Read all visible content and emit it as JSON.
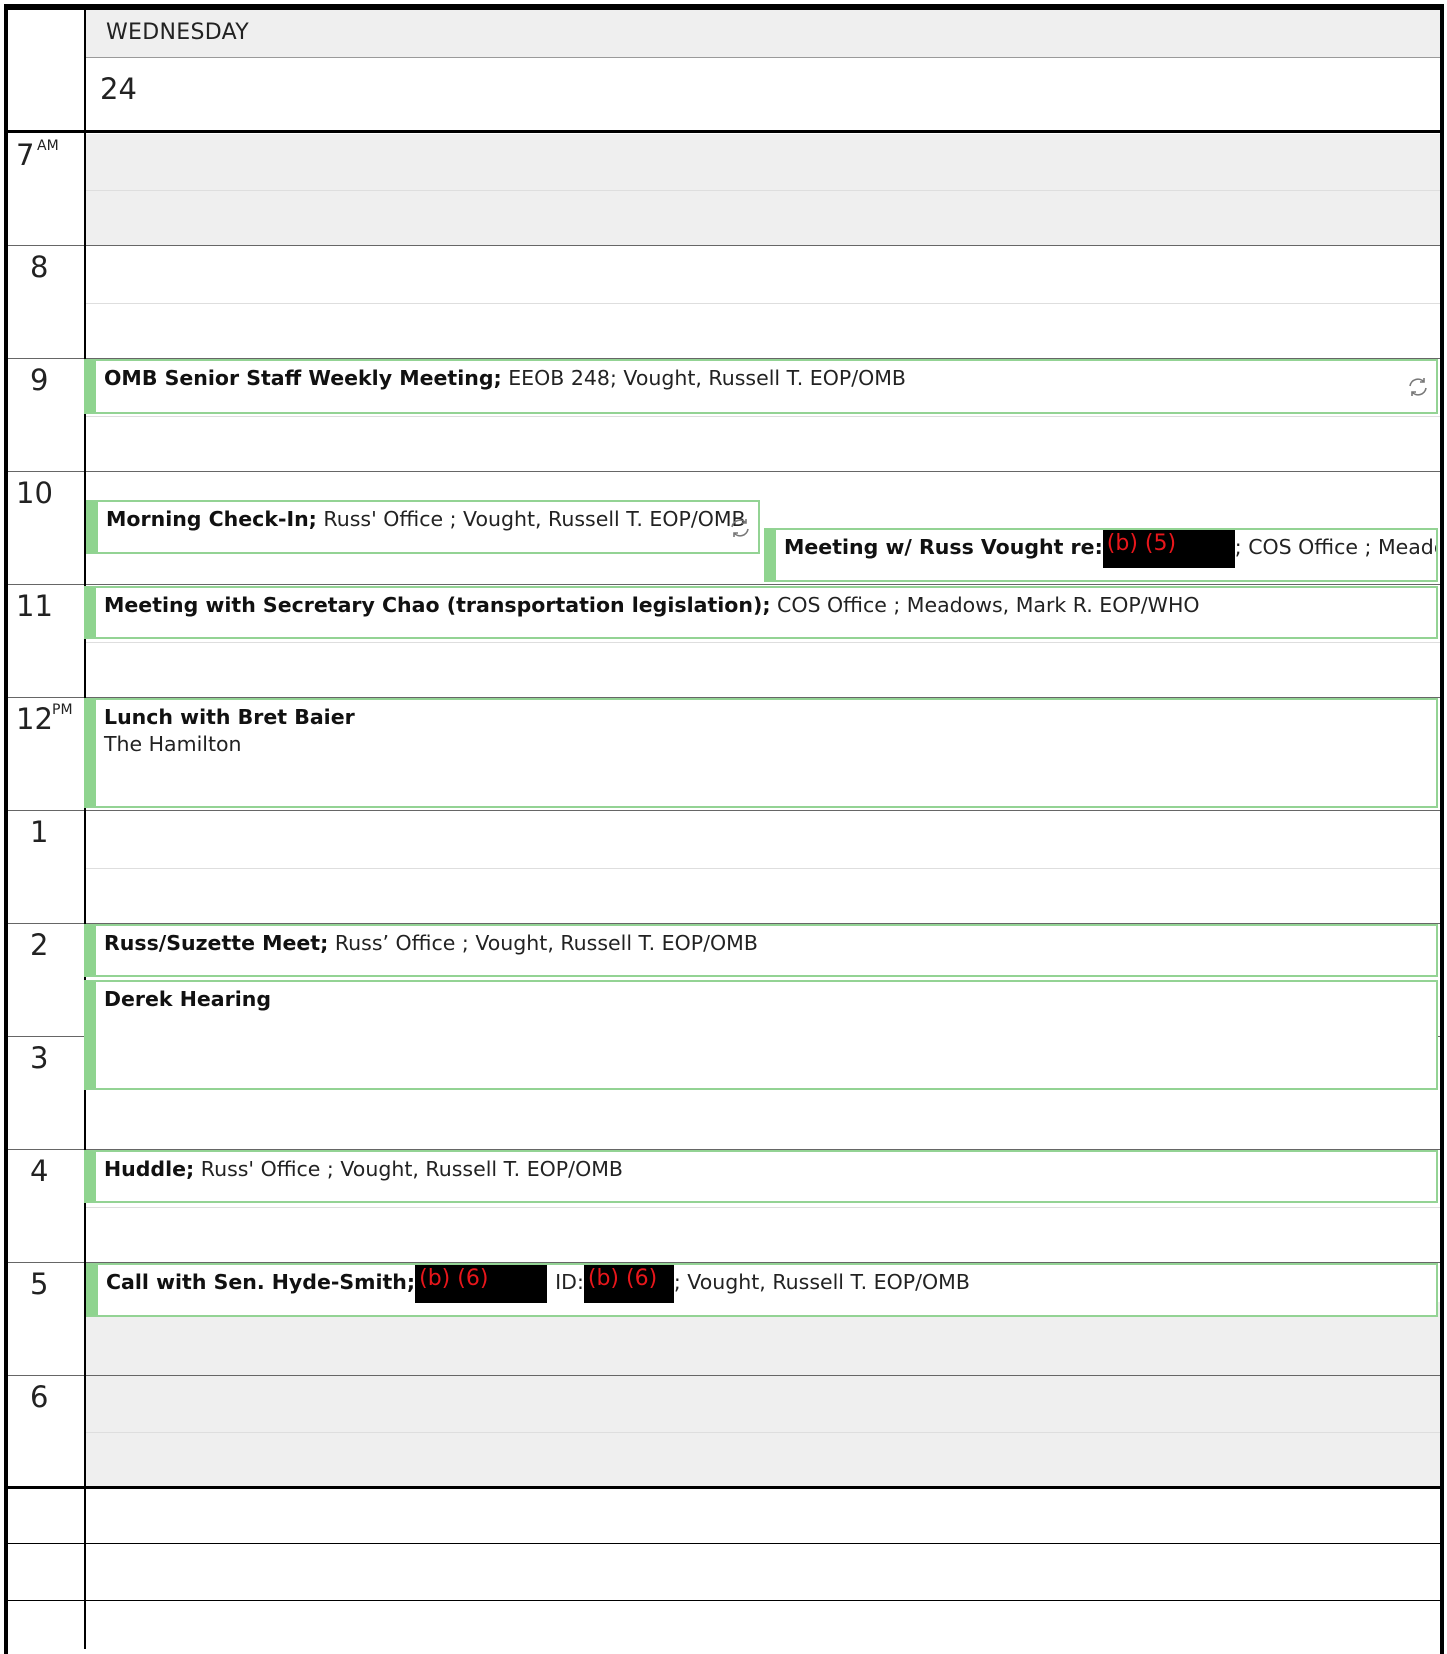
{
  "header": {
    "day_name": "WEDNESDAY",
    "day_number": "24"
  },
  "hours": [
    {
      "label": "7",
      "suffix": "AM"
    },
    {
      "label": "8",
      "suffix": ""
    },
    {
      "label": "9",
      "suffix": ""
    },
    {
      "label": "10",
      "suffix": ""
    },
    {
      "label": "11",
      "suffix": ""
    },
    {
      "label": "12",
      "suffix": "PM"
    },
    {
      "label": "1",
      "suffix": ""
    },
    {
      "label": "2",
      "suffix": ""
    },
    {
      "label": "3",
      "suffix": ""
    },
    {
      "label": "4",
      "suffix": ""
    },
    {
      "label": "5",
      "suffix": ""
    },
    {
      "label": "6",
      "suffix": ""
    }
  ],
  "events": {
    "omb_weekly": {
      "title": "OMB Senior Staff Weekly Meeting;",
      "details": " EEOB 248; Vought, Russell T. EOP/OMB",
      "icon": "sync-icon"
    },
    "morning_checkin": {
      "title": "Morning Check-In;",
      "details": " Russ' Office ; Vought, Russell T. EOP/OMB",
      "icon": "sync-icon"
    },
    "vought_meeting": {
      "title": "Meeting w/ Russ Vought re:",
      "redaction": "(b) (5)",
      "details": "; COS Office ; Meadows, M"
    },
    "chao_meeting": {
      "title": "Meeting with Secretary Chao (transportation legislation);",
      "details": " COS Office ; Meadows, Mark R. EOP/WHO"
    },
    "lunch": {
      "title": "Lunch with Bret Baier",
      "location": "The Hamilton"
    },
    "russ_suzette": {
      "title": "Russ/Suzette Meet;",
      "details": " Russ’ Office ; Vought, Russell T. EOP/OMB"
    },
    "derek_hearing": {
      "title": "Derek Hearing"
    },
    "huddle": {
      "title": "Huddle;",
      "details": " Russ' Office ; Vought, Russell T. EOP/OMB"
    },
    "hyde_smith_call": {
      "title": "Call with Sen. Hyde-Smith;",
      "redaction_1": "(b) (6)",
      "id_label": "ID:",
      "redaction_2": "(b) (6)",
      "details": "; Vought, Russell T. EOP/OMB"
    }
  },
  "colors": {
    "event_accent": "#8fd48f",
    "event_border": "#93d394",
    "redaction_fill": "#000000",
    "redaction_text": "#e8161b",
    "off_hours": "#efefef"
  }
}
